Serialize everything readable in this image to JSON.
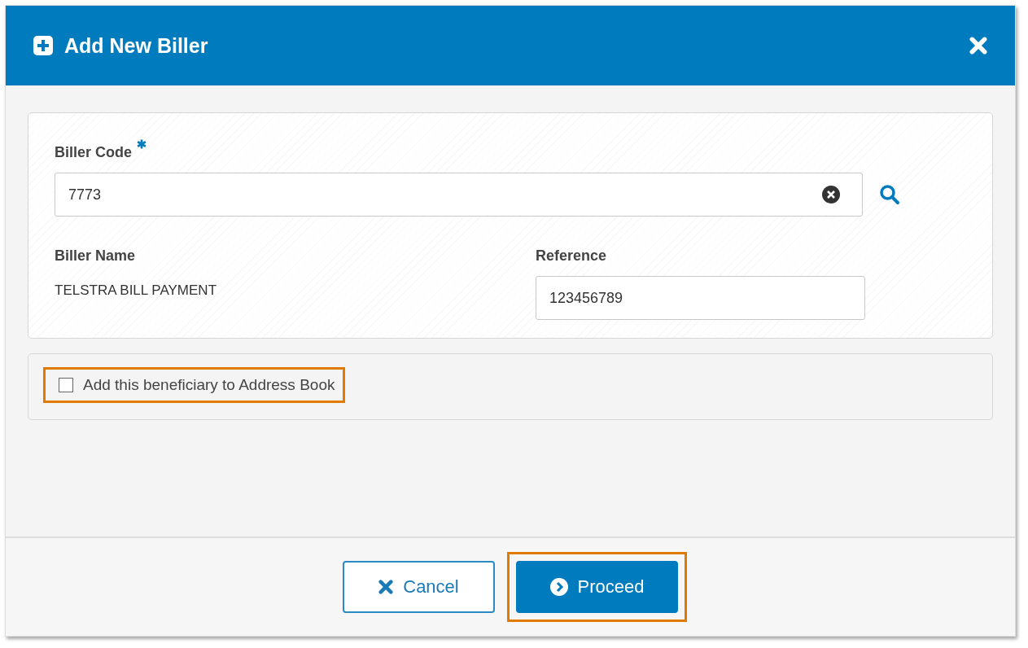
{
  "dialog": {
    "title": "Add New Biller"
  },
  "biller_code": {
    "label": "Biller Code",
    "required": true,
    "value": "7773"
  },
  "biller_name": {
    "label": "Biller Name",
    "value": "TELSTRA BILL PAYMENT"
  },
  "reference": {
    "label": "Reference",
    "value": "123456789"
  },
  "address_book": {
    "label": "Add this beneficiary to Address Book",
    "checked": false,
    "highlighted": true
  },
  "buttons": [
    {
      "kind": "cancel",
      "label": "Cancel",
      "highlighted": false
    },
    {
      "kind": "proceed",
      "label": "Proceed",
      "highlighted": true
    }
  ]
}
